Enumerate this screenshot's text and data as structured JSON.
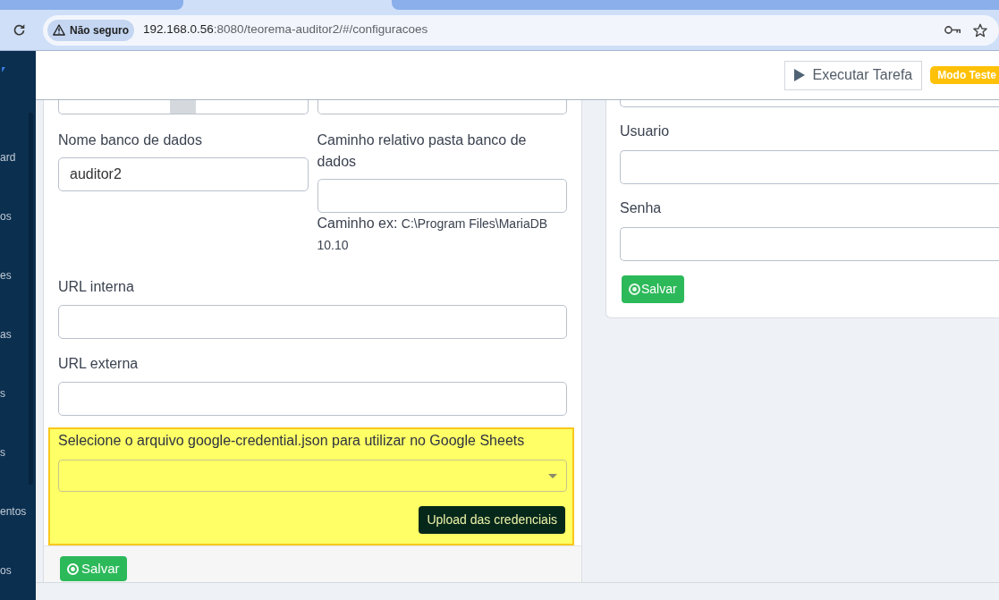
{
  "browser": {
    "security_chip": "Não seguro",
    "url": {
      "host": "192.168.0.56",
      "rest": ":8080/teorema-auditor2/#/configuracoes"
    }
  },
  "sidebar": {
    "items": [
      {
        "label": "ard"
      },
      {
        "label": "os"
      },
      {
        "label": "es"
      },
      {
        "label": "as"
      },
      {
        "label": "s"
      },
      {
        "label": "s"
      },
      {
        "label": "entos"
      },
      {
        "label": "os"
      }
    ]
  },
  "header": {
    "run_task_button": "Executar Tarefa",
    "mode_badge": "Modo Teste"
  },
  "database_card": {
    "fields": [
      {
        "label": "Nome banco de dados",
        "value": "auditor2"
      },
      {
        "label": "Caminho relativo pasta banco de dados",
        "help_label": "Caminho ex:",
        "help_path": "C:\\Program Files\\MariaDB 10.10"
      }
    ],
    "url_fields": [
      {
        "label": "URL interna"
      },
      {
        "label": "URL externa"
      }
    ],
    "credentials": {
      "label": "Selecione o arquivo google-credential.json para utilizar no Google Sheets",
      "upload_button": "Upload das credenciais"
    },
    "save_button": "Salvar"
  },
  "auth_card": {
    "fields": [
      {
        "label": "Usuario"
      },
      {
        "label": "Senha"
      }
    ],
    "save_button": "Salvar"
  }
}
